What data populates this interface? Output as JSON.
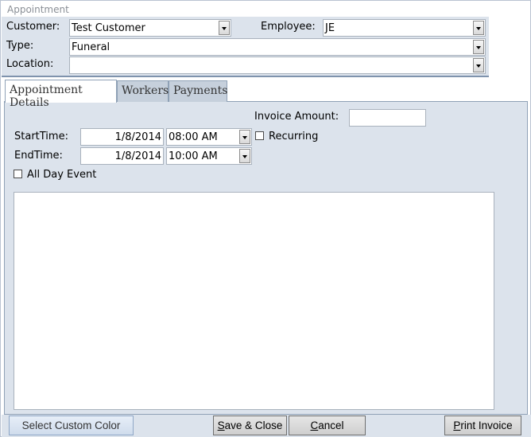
{
  "window": {
    "title": "Appointment"
  },
  "header": {
    "customer_label": "Customer:",
    "customer_value": "Test Customer",
    "employee_label": "Employee:",
    "employee_value": "JE",
    "type_label": "Type:",
    "type_value": "Funeral",
    "location_label": "Location:",
    "location_value": ""
  },
  "tabs": [
    {
      "label": "Appointment Details",
      "active": true
    },
    {
      "label": "Workers",
      "active": false
    },
    {
      "label": "Payments",
      "active": false
    }
  ],
  "details": {
    "invoice_label": "Invoice Amount:",
    "invoice_value": "",
    "start_label": "StartTime:",
    "start_date": "1/8/2014",
    "start_time": "08:00 AM",
    "recurring_label": "Recurring",
    "recurring_checked": false,
    "end_label": "EndTime:",
    "end_date": "1/8/2014",
    "end_time": "10:00 AM",
    "allday_label": "All Day Event",
    "allday_checked": false,
    "notes": ""
  },
  "footer": {
    "custom_color_label": "Select Custom Color",
    "save_close_label": "Save & Close",
    "cancel_label": "Cancel",
    "print_invoice_label": "Print Invoice"
  },
  "icons": {
    "dropdown": "chevron-down-icon",
    "checkbox": "checkbox-icon"
  },
  "colors": {
    "form_background": "#dce3ec",
    "tab_background": "#c6d0dc",
    "border": "#8fa1b6"
  }
}
